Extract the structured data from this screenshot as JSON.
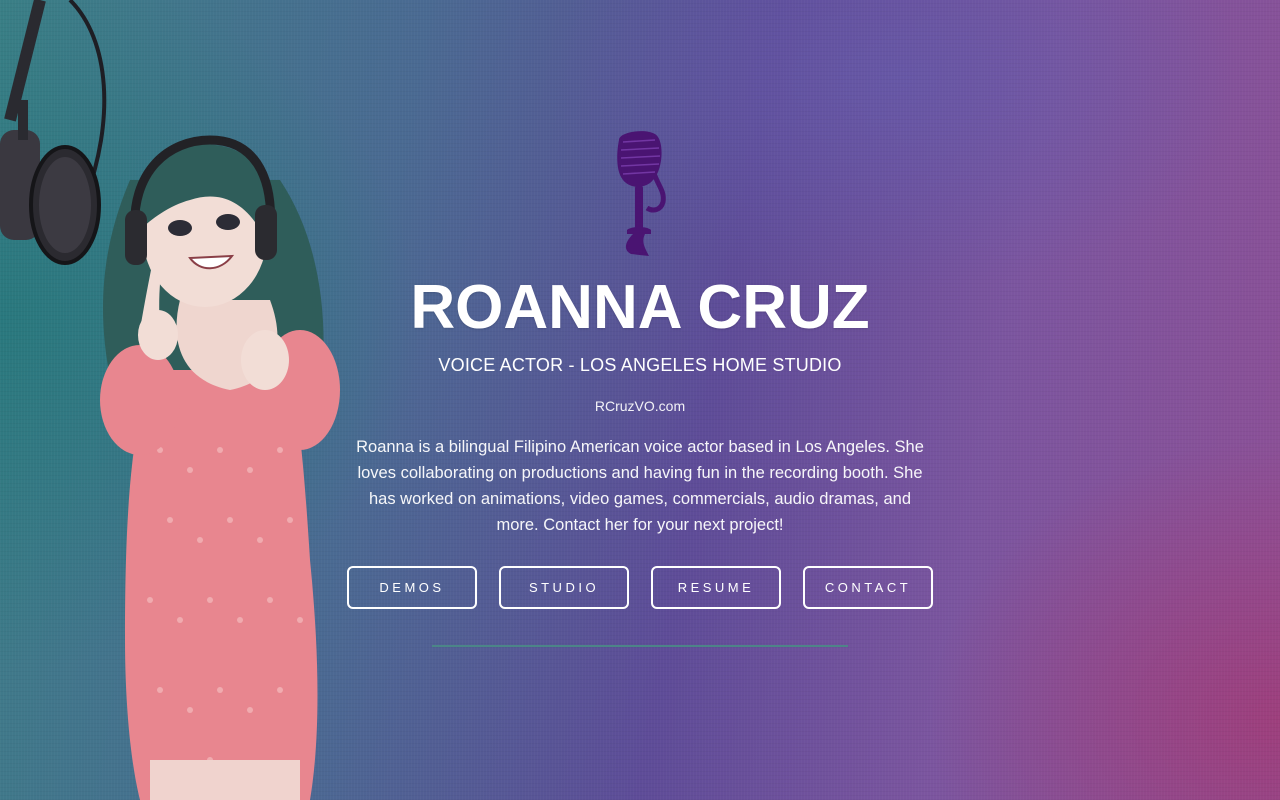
{
  "header": {
    "name": "ROANNA CRUZ",
    "tagline": "VOICE ACTOR - LOS ANGELES HOME STUDIO",
    "website": "RCruzVO.com"
  },
  "bio": "Roanna is a bilingual Filipino American voice actor based in Los Angeles. She loves collaborating on productions and having fun in the recording booth. She has worked on animations, video games, commercials, audio dramas, and more. Contact her for your next project!",
  "nav": {
    "demos": "DEMOS",
    "studio": "STUDIO",
    "resume": "RESUME",
    "contact": "CONTACT"
  },
  "icons": {
    "logo": "microphone-icon",
    "illustration": "voice-actor-illustration"
  },
  "colors": {
    "logo": "#4a1472",
    "button_border": "#ffffff",
    "divider": "#4a8a86",
    "dress": "#e8868f",
    "hair": "#2f5d5a"
  }
}
